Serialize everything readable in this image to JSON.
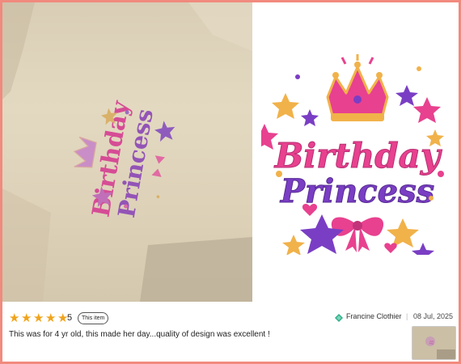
{
  "design": {
    "word1": "Birthday",
    "word2": "Princess"
  },
  "review": {
    "rating": "5",
    "badge": "This item",
    "seller": "Francine Clothier",
    "separator": "|",
    "date": "08 Jul, 2025",
    "text": "This was for 4 yr old, this made her day...quality of design was excellent !",
    "stars": 5
  },
  "colors": {
    "frame": "#f18a7e",
    "star": "#f0a31b",
    "pink": "#e8418f",
    "purple": "#7a3ec4",
    "gold": "#f1b24a"
  },
  "icons": {
    "seller": "seller-icon"
  }
}
